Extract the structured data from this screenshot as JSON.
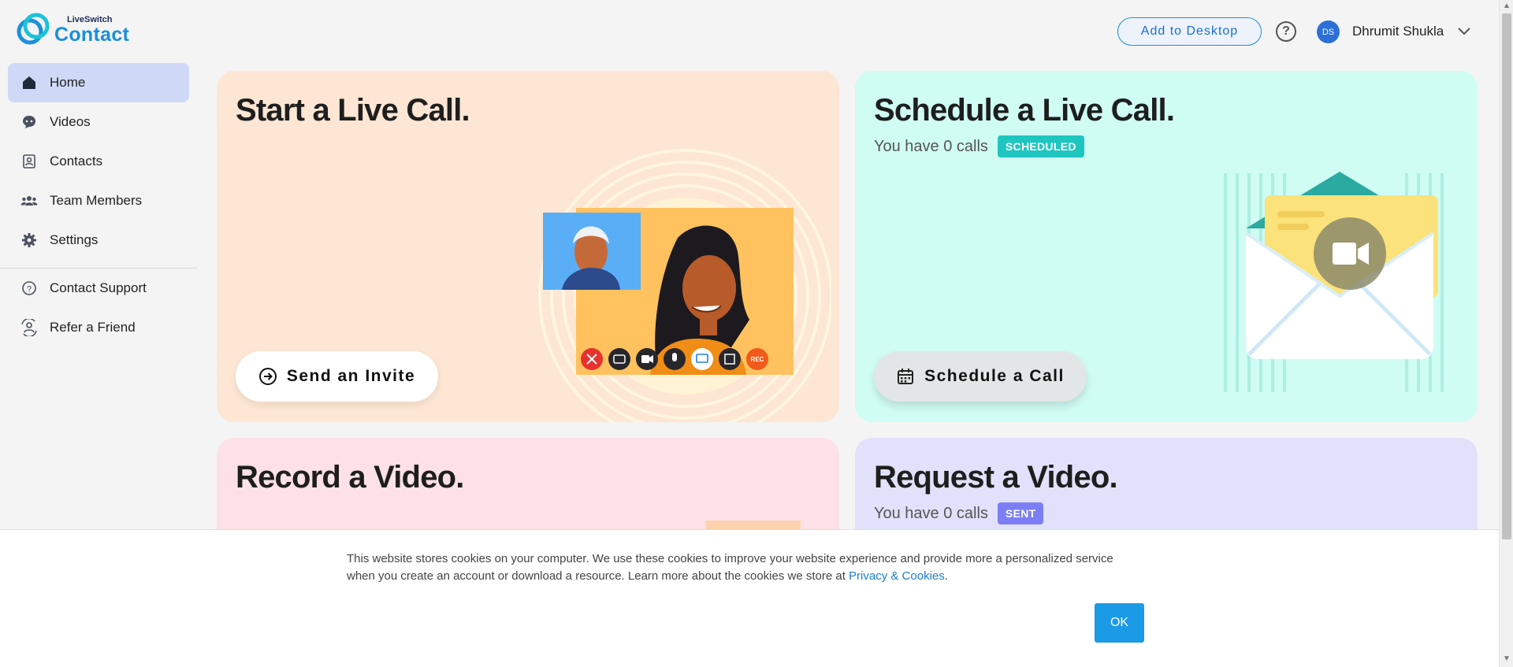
{
  "header": {
    "logo_small": "LiveSwitch",
    "logo_big": "Contact",
    "add_desktop": "Add to Desktop",
    "help_glyph": "?",
    "avatar_initials": "DS",
    "user_name": "Dhrumit Shukla"
  },
  "sidebar": {
    "items": [
      {
        "label": "Home",
        "icon": "home-icon"
      },
      {
        "label": "Videos",
        "icon": "chat-bubble-icon"
      },
      {
        "label": "Contacts",
        "icon": "contacts-icon"
      },
      {
        "label": "Team Members",
        "icon": "team-icon"
      },
      {
        "label": "Settings",
        "icon": "gear-icon"
      },
      {
        "label": "Contact Support",
        "icon": "help-circle-icon"
      },
      {
        "label": "Refer a Friend",
        "icon": "refer-icon"
      }
    ]
  },
  "cards": {
    "start": {
      "title": "Start a Live Call.",
      "button": "Send an Invite"
    },
    "schedule": {
      "title": "Schedule a Live Call.",
      "sub": "You have 0 calls",
      "badge": "SCHEDULED",
      "button": "Schedule a Call"
    },
    "record": {
      "title": "Record a Video."
    },
    "request": {
      "title": "Request a Video.",
      "sub": "You have 0 calls",
      "badge": "SENT"
    }
  },
  "call_controls": {
    "rec_label": "REC"
  },
  "cookie": {
    "text": "This website stores cookies on your computer. We use these cookies to improve your website experience and provide more a personalized service when you create an account or download a resource. Learn more about the cookies we store at ",
    "link": "Privacy & Cookies",
    "suffix": ".",
    "ok": "OK"
  },
  "colors": {
    "accent": "#1b8fdc",
    "active_nav": "#cfd9f7",
    "start_bg": "#fde6d3",
    "schedule_bg": "#cffcf3",
    "record_bg": "#fde1e6",
    "request_bg": "#e1e1fb"
  }
}
